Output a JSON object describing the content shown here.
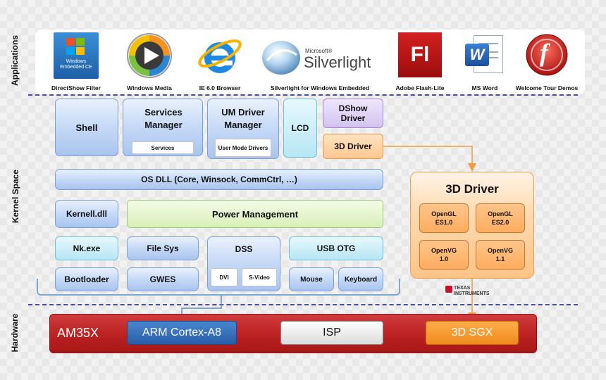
{
  "sections": {
    "applications": "Applications",
    "kernel": "Kernel Space",
    "hardware": "Hardware"
  },
  "apps": [
    {
      "label": "DirectShow Filter",
      "icon": "windows-embedded-ce-icon",
      "caption": "Windows Embedded CE"
    },
    {
      "label": "Windows Media",
      "icon": "windows-media-player-icon"
    },
    {
      "label": "IE 6.0 Browser",
      "icon": "internet-explorer-icon"
    },
    {
      "label": "Silverlight for Windows Embedded",
      "icon": "silverlight-icon",
      "brand_small": "Microsoft®",
      "brand_big": "Silverlight"
    },
    {
      "label": "Adobe Flash-Lite",
      "icon": "flash-lite-icon",
      "glyph": "Fl"
    },
    {
      "label": "MS Word",
      "icon": "ms-word-icon",
      "glyph": "W"
    },
    {
      "label": "Welcome Tour Demos",
      "icon": "flash-player-icon",
      "glyph": "f"
    }
  ],
  "kernel": {
    "shell": "Shell",
    "services_manager": "Services Manager",
    "services": "Services",
    "um_driver_manager": "UM Driver Manager",
    "user_mode_drivers": "User Mode Drivers",
    "lcd": "LCD",
    "dshow_driver": "DShow Driver",
    "driver_3d_small": "3D Driver",
    "os_dll": "OS DLL (Core, Winsock, CommCtrl, …)",
    "kernel_dll": "Kernell.dll",
    "power_management": "Power Management",
    "nk_exe": "Nk.exe",
    "file_sys": "File Sys",
    "dss": "DSS",
    "dvi": "DVI",
    "svideo": "S-Video",
    "usb_otg": "USB OTG",
    "bootloader": "Bootloader",
    "gwes": "GWES",
    "mouse": "Mouse",
    "keyboard": "Keyboard"
  },
  "driver_panel": {
    "title": "3D Driver",
    "apis": [
      {
        "name": "OpenGL",
        "ver": "ES1.0"
      },
      {
        "name": "OpenGL",
        "ver": "ES2.0"
      },
      {
        "name": "OpenVG",
        "ver": "1.0"
      },
      {
        "name": "OpenVG",
        "ver": "1.1"
      }
    ]
  },
  "vendor": {
    "line1": "Texas",
    "line2": "Instruments"
  },
  "hardware": {
    "chip": "AM35X",
    "cpu": "ARM Cortex-A8",
    "isp": "ISP",
    "gpu": "3D SGX"
  },
  "colors": {
    "accent_blue": "#2f6db5",
    "hw_red": "#b81f1f",
    "gpu_orange": "#f08a1c",
    "divider": "#4b4ba0"
  }
}
